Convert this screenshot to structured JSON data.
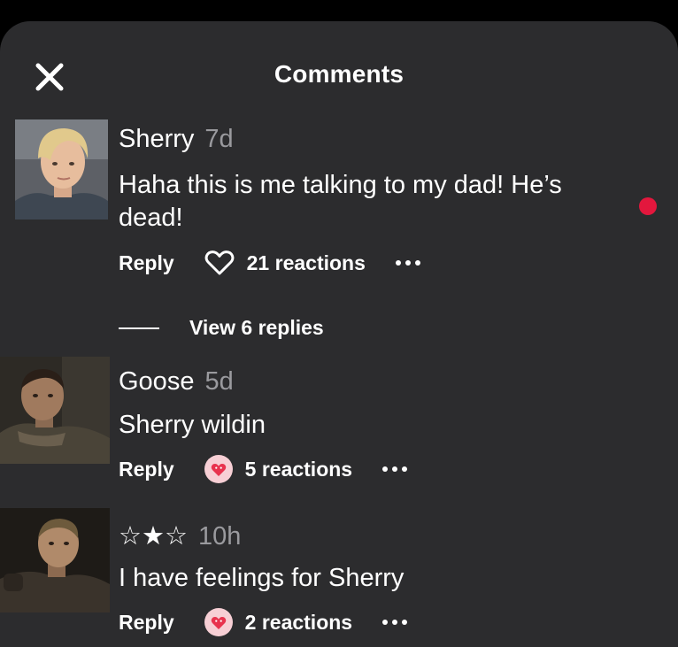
{
  "header": {
    "title": "Comments",
    "close_icon": "close-icon"
  },
  "colors": {
    "sheet_bg": "#2c2c2e",
    "muted_text": "#9a9a9e",
    "unread_dot": "#e3173d",
    "heart_badge_bg": "#f7cfd5",
    "heart_color": "#e8334e"
  },
  "comments": [
    {
      "author": "Sherry",
      "age": "7d",
      "text_line1": "Haha this is me talking to my dad! He’s",
      "text_line2": "dead!",
      "reply_label": "Reply",
      "reaction_icon": "heart-outline-icon",
      "reactions": "21 reactions",
      "unread": true,
      "view_replies": "View 6 replies"
    },
    {
      "author": "Goose",
      "age": "5d",
      "text": "Sherry wildin",
      "reply_label": "Reply",
      "reaction_icon": "heart-badge-icon",
      "reactions": "5 reactions"
    },
    {
      "author": "☆★☆",
      "age": "10h",
      "text": "I have feelings for Sherry",
      "reply_label": "Reply",
      "reaction_icon": "heart-badge-icon",
      "reactions": "2 reactions"
    }
  ]
}
